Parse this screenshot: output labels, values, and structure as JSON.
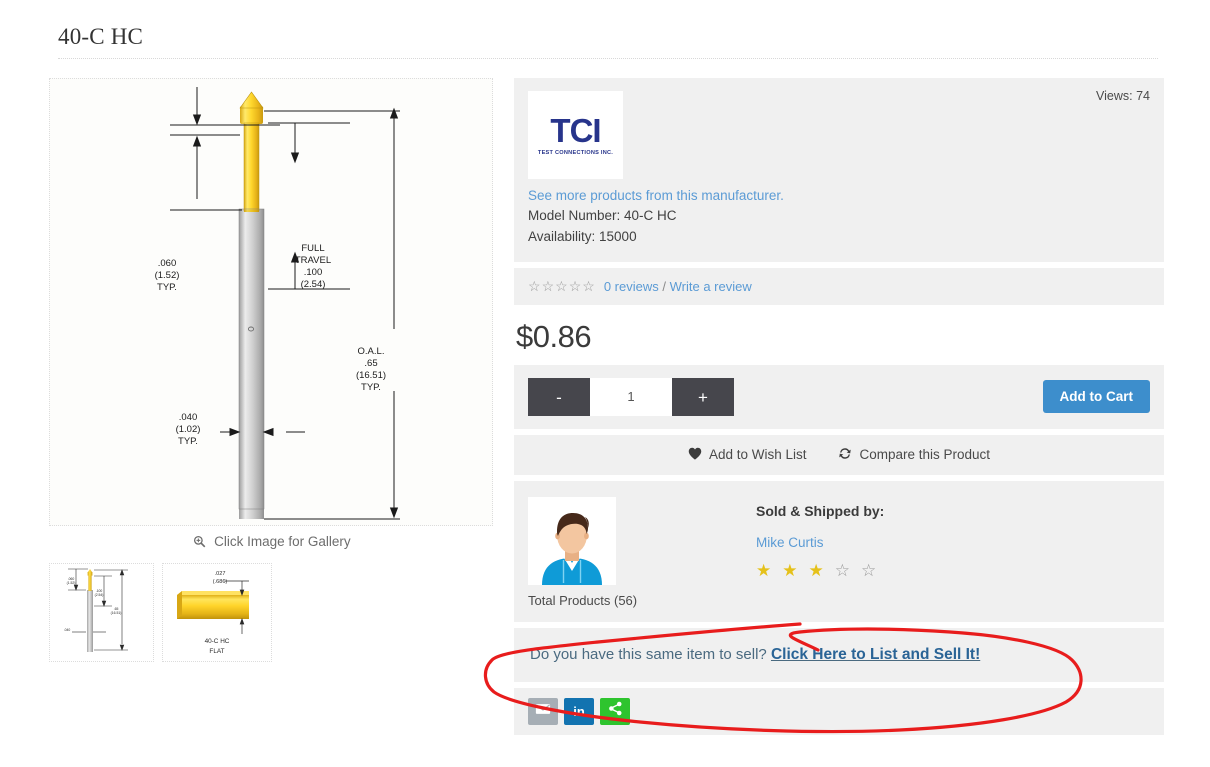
{
  "page_title": "40-C HC",
  "gallery": {
    "caption": "Click Image for Gallery",
    "zoom_icon": "magnifier-plus-icon",
    "main_drawing": {
      "dim_top_left": ".060\n(1.52)\nTYP.",
      "dim_top_left_lines": [
        ".060",
        "(1.52)",
        "TYP."
      ],
      "dim_travel_lines": [
        "FULL",
        "TRAVEL",
        ".100",
        "(2.54)"
      ],
      "dim_oal_lines": [
        "O.A.L.",
        ".65",
        "(16.51)",
        "TYP."
      ],
      "dim_diameter_lines": [
        ".040",
        "(1.02)",
        "TYP."
      ]
    },
    "thumbnails": [
      {
        "name": "probe-profile-thumb",
        "label": ""
      },
      {
        "name": "flat-tip-thumb",
        "label_lines": [
          "40-C HC",
          "FLAT"
        ],
        "dim_lines": [
          ".027",
          "(.686)"
        ]
      }
    ]
  },
  "manufacturer": {
    "views_label": "Views: 74",
    "logo_mark": "TCI",
    "logo_sub": "TEST CONNECTIONS INC.",
    "more_products_link": "See more products from this manufacturer.",
    "model_number": "Model Number: 40-C HC",
    "availability": "Availability: 15000"
  },
  "reviews": {
    "star_count": 5,
    "filled": 0,
    "count_label": "0 reviews",
    "separator": "/",
    "write_label": "Write a review"
  },
  "price": "$0.86",
  "cart": {
    "minus_label": "-",
    "plus_label": "+",
    "quantity": "1",
    "add_to_cart_label": "Add to Cart"
  },
  "actions": {
    "wish_icon": "heart-icon",
    "wish_label": "Add to Wish List",
    "compare_icon": "refresh-icon",
    "compare_label": "Compare this Product"
  },
  "seller": {
    "avatar": "user-avatar",
    "total_products": "Total Products (56)",
    "sold_by_label": "Sold & Shipped by:",
    "seller_name": "Mike Curtis",
    "rating_filled": 3,
    "rating_total": 5
  },
  "sell_banner": {
    "prompt": "Do you have this same item to sell? ",
    "cta": "Click Here to List and Sell It!"
  },
  "share": [
    {
      "name": "share-email-button",
      "icon": "envelope-icon",
      "label": ""
    },
    {
      "name": "share-linkedin-button",
      "icon": "linkedin-icon",
      "label": "in"
    },
    {
      "name": "share-generic-button",
      "icon": "share-nodes-icon",
      "label": ""
    }
  ],
  "colors": {
    "accent_blue": "#3d8ecc",
    "link_blue": "#5b9bd5",
    "panel_gray": "#f0f0f0",
    "dark_button": "#46464c",
    "star_gold": "#e5c11a",
    "brand_navy": "#27348b",
    "annotation_red": "#e81c1c",
    "share_green": "#2ec42e",
    "share_linkedin": "#1273b0"
  }
}
